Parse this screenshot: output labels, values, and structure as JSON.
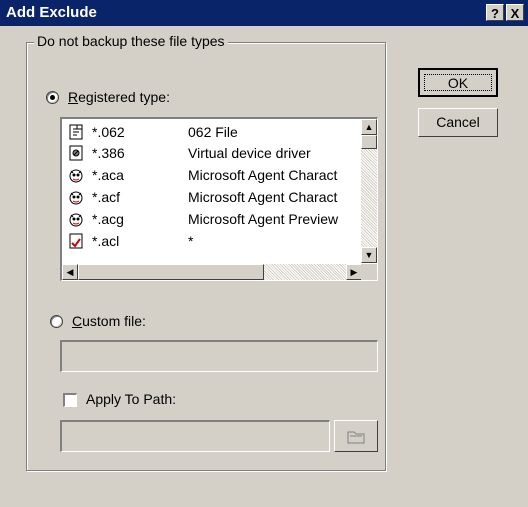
{
  "window": {
    "title": "Add Exclude",
    "help_btn": "?",
    "close_btn": "X"
  },
  "group": {
    "legend": "Do not backup these file types"
  },
  "registered": {
    "label_prefix": "",
    "label_underline": "R",
    "label_rest": "egistered type:",
    "selected": true
  },
  "files": [
    {
      "ext": "*.062",
      "desc": "062 File",
      "icon": "document-icon"
    },
    {
      "ext": "*.386",
      "desc": "Virtual device driver",
      "icon": "driver-icon"
    },
    {
      "ext": "*.aca",
      "desc": "Microsoft Agent Charact",
      "icon": "agent-character-icon"
    },
    {
      "ext": "*.acf",
      "desc": "Microsoft Agent Charact",
      "icon": "agent-character-icon"
    },
    {
      "ext": "*.acg",
      "desc": "Microsoft Agent Preview",
      "icon": "agent-character-icon"
    },
    {
      "ext": "*.acl",
      "desc": "*",
      "icon": "autocorrect-icon"
    }
  ],
  "custom": {
    "label_underline": "C",
    "label_rest": "ustom file:",
    "selected": false,
    "value": ""
  },
  "apply_path": {
    "label": "Apply To Path:",
    "checked": false,
    "value": ""
  },
  "buttons": {
    "ok": "OK",
    "cancel": "Cancel"
  }
}
